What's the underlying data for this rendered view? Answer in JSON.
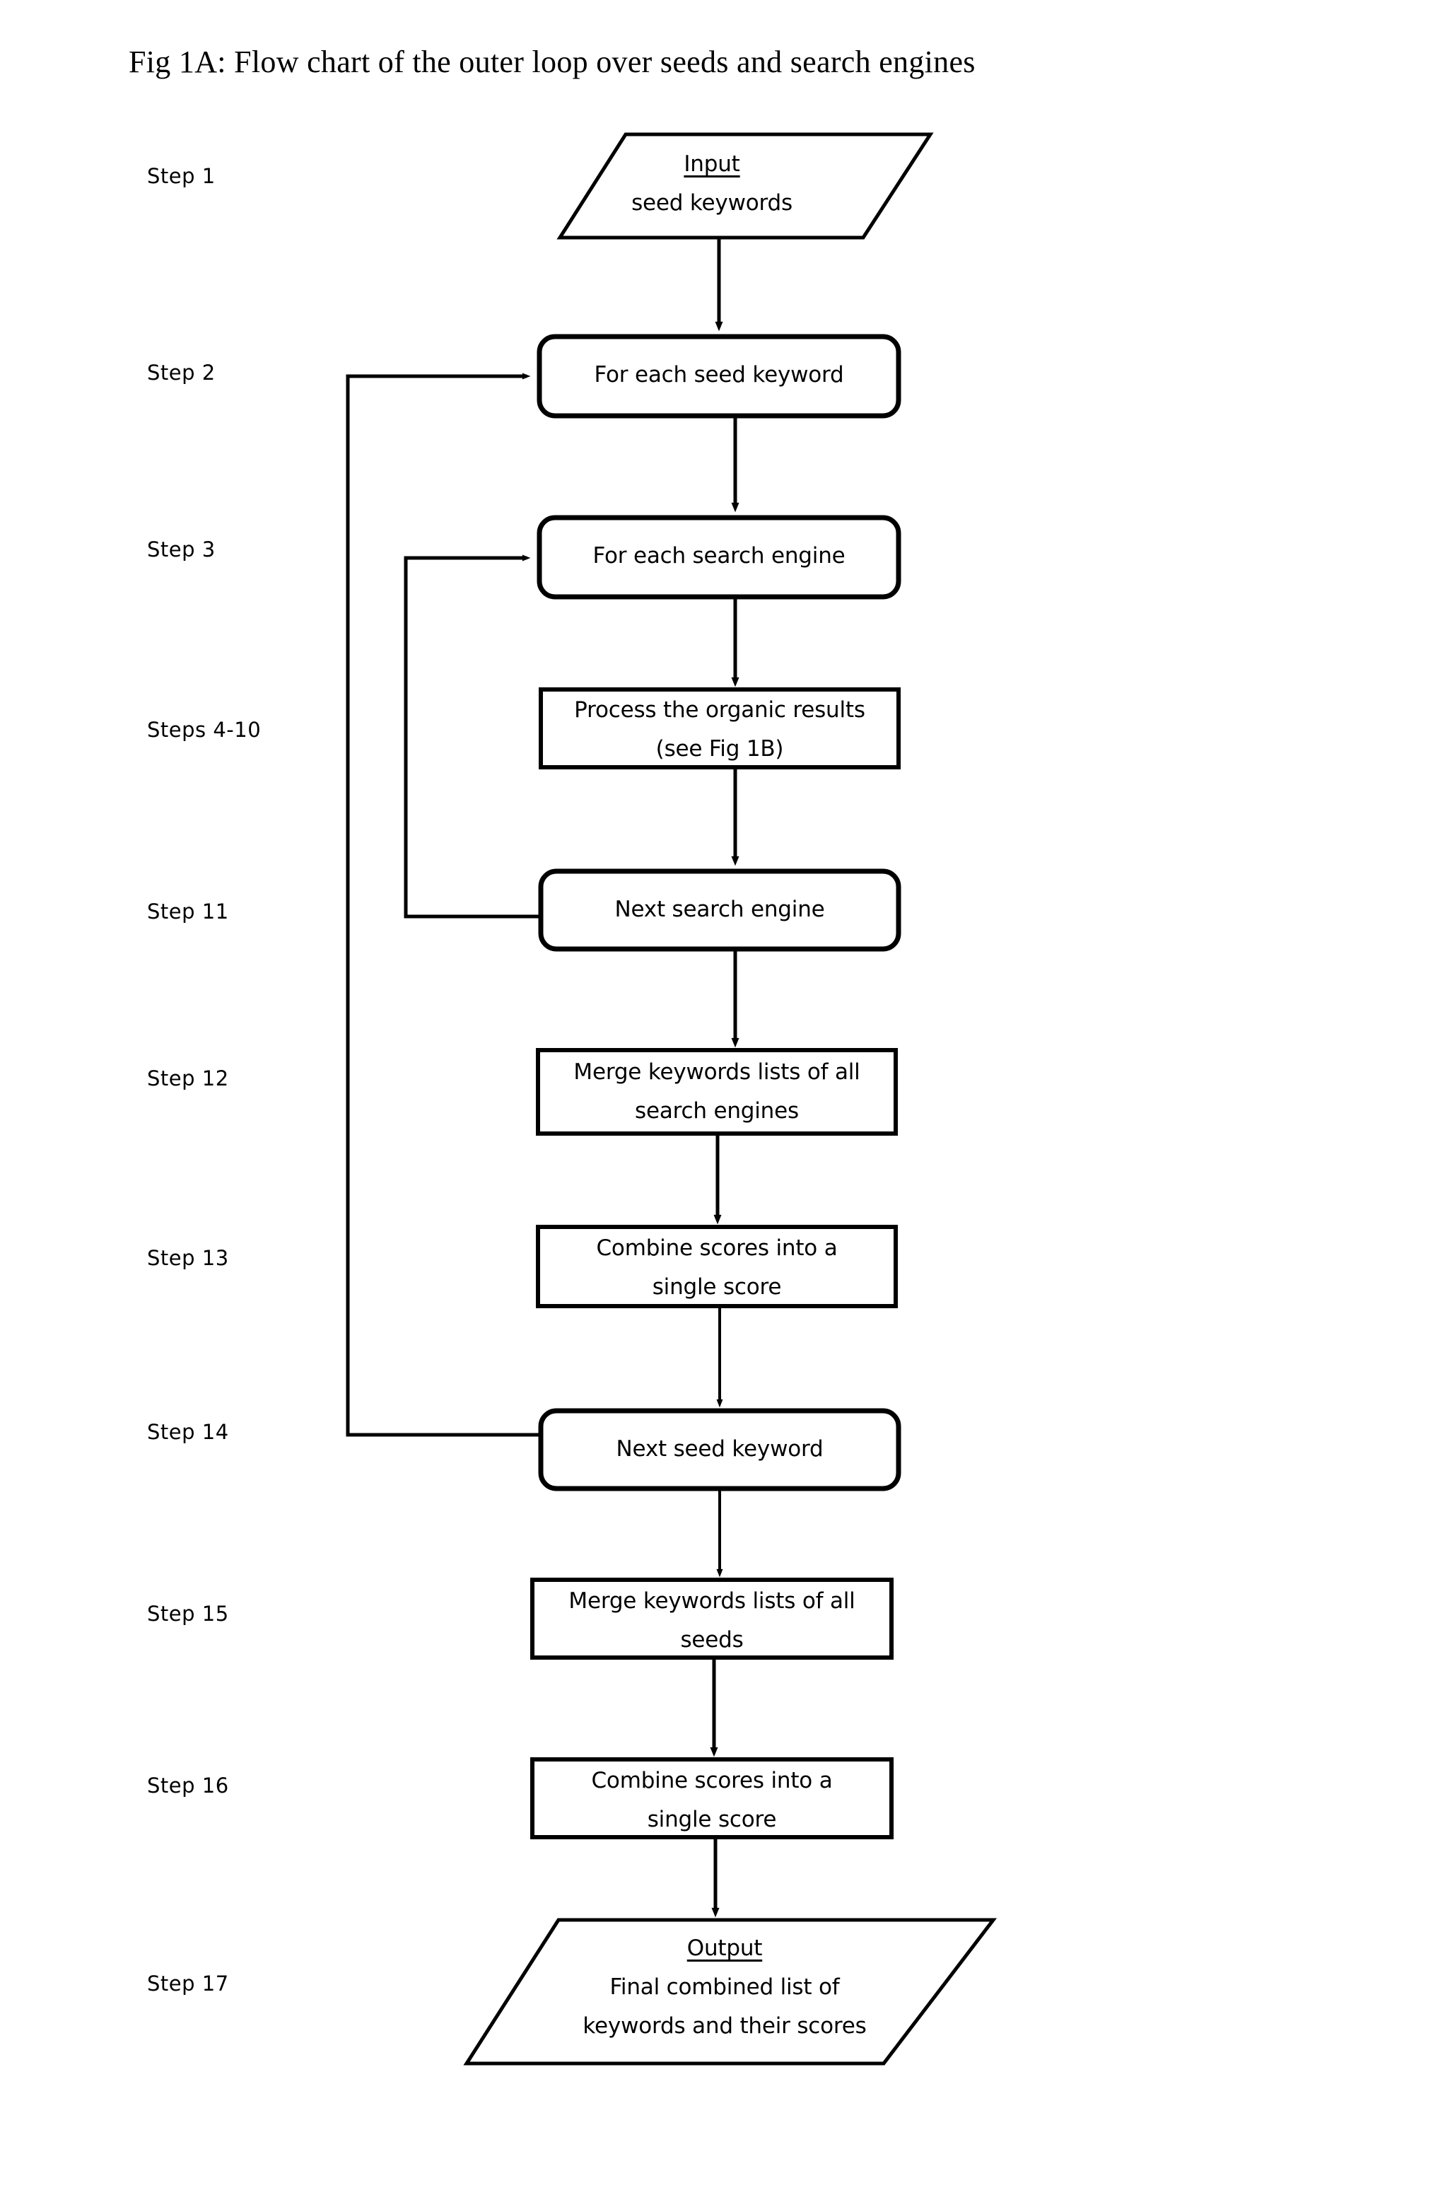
{
  "figure": {
    "title": "Fig 1A: Flow chart of the outer loop over seeds and search engines"
  },
  "steps": [
    {
      "id": "step-1",
      "label": "Step 1"
    },
    {
      "id": "step-2",
      "label": "Step 2"
    },
    {
      "id": "step-3",
      "label": "Step 3"
    },
    {
      "id": "step-4",
      "label": "Steps 4-10"
    },
    {
      "id": "step-11",
      "label": "Step 11"
    },
    {
      "id": "step-12",
      "label": "Step 12"
    },
    {
      "id": "step-13",
      "label": "Step 13"
    },
    {
      "id": "step-14",
      "label": "Step 14"
    },
    {
      "id": "step-15",
      "label": "Step 15"
    },
    {
      "id": "step-16",
      "label": "Step 16"
    },
    {
      "id": "step-17",
      "label": "Step 17"
    }
  ],
  "nodes": {
    "input": {
      "shape": "parallelogram",
      "heading": "Input",
      "line1": "seed keywords"
    },
    "for_each_seed": {
      "shape": "rounded-rect",
      "line1": "For each seed keyword"
    },
    "for_each_engine": {
      "shape": "rounded-rect",
      "line1": "For each search engine"
    },
    "process_organic": {
      "shape": "rect",
      "line1": "Process the organic results",
      "line2": "(see Fig 1B)"
    },
    "next_engine": {
      "shape": "rounded-rect",
      "line1": "Next search engine"
    },
    "merge_engines": {
      "shape": "rect",
      "line1": "Merge keywords lists of all",
      "line2": "search engines"
    },
    "combine_engines": {
      "shape": "rect",
      "line1": "Combine scores into a",
      "line2": "single score"
    },
    "next_seed": {
      "shape": "rounded-rect",
      "line1": "Next seed keyword"
    },
    "merge_seeds": {
      "shape": "rect",
      "line1": "Merge keywords lists of all",
      "line2": "seeds"
    },
    "combine_seeds": {
      "shape": "rect",
      "line1": "Combine scores into a",
      "line2": "single score"
    },
    "output": {
      "shape": "parallelogram",
      "heading": "Output",
      "line1": "Final combined list of",
      "line2": "keywords and their scores"
    }
  },
  "colors": {
    "stroke": "#000000",
    "background": "#ffffff",
    "text": "#000000"
  }
}
